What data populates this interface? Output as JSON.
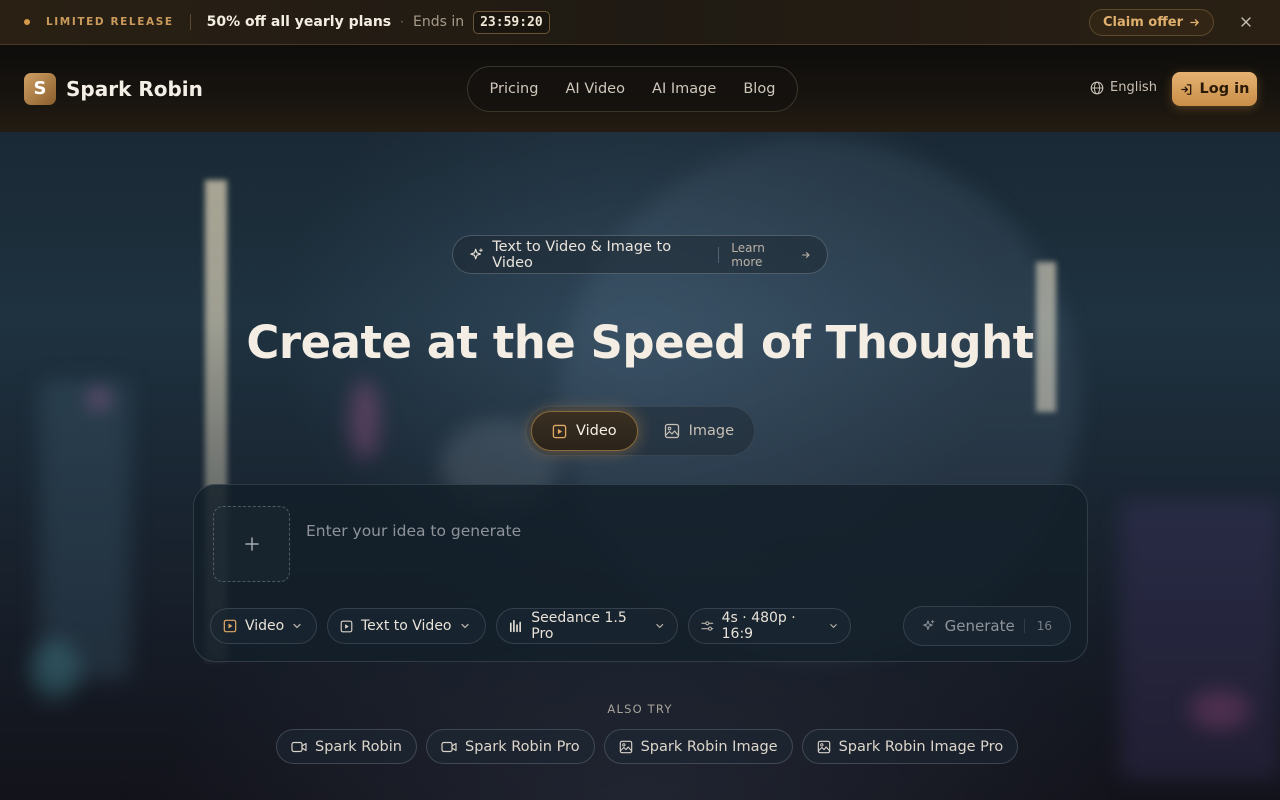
{
  "promo": {
    "label": "LIMITED RELEASE",
    "headline": "50% off all yearly plans",
    "separator": "·",
    "ends_label": "Ends in",
    "timer": "23:59:20",
    "claim_label": "Claim offer"
  },
  "nav": {
    "brand_letter": "S",
    "brand_name": "Spark Robin",
    "links": [
      "Pricing",
      "AI Video",
      "AI Image",
      "Blog"
    ],
    "language": "English",
    "login_label": "Log in"
  },
  "hero": {
    "pill_text": "Text to Video & Image to Video",
    "pill_link": "Learn more",
    "title": "Create at the Speed of Thought",
    "modes": [
      {
        "label": "Video",
        "active": true
      },
      {
        "label": "Image",
        "active": false
      }
    ]
  },
  "composer": {
    "placeholder": "Enter your idea to generate",
    "value": "",
    "chips": {
      "output_type": "Video",
      "input_mode": "Text to Video",
      "model": "Seedance 1.5 Pro",
      "settings": "4s · 480p · 16:9"
    },
    "generate_label": "Generate",
    "credit_cost": "16"
  },
  "also_try": {
    "label": "ALSO TRY",
    "items": [
      "Spark Robin",
      "Spark Robin Pro",
      "Spark Robin Image",
      "Spark Robin Image Pro"
    ]
  },
  "colors": {
    "accent": "#d59a48",
    "login_bg": "#e0a862",
    "promo_bg": "#2a2014"
  },
  "icons": {
    "close": "close-icon",
    "claim_arrow": "arrow-right-icon",
    "globe": "globe-icon",
    "login": "login-icon",
    "sparkle": "sparkle-icon",
    "video": "video-icon",
    "image": "image-icon",
    "plus": "plus-icon"
  }
}
